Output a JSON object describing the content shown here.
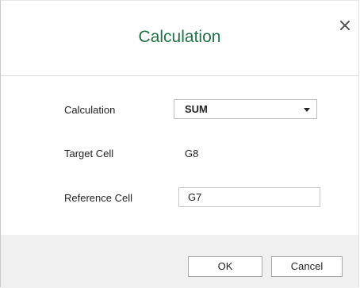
{
  "dialog": {
    "title": "Calculation",
    "close_icon": "close-icon"
  },
  "form": {
    "calculation_label": "Calculation",
    "calculation_value": "SUM",
    "target_cell_label": "Target Cell",
    "target_cell_value": "G8",
    "reference_cell_label": "Reference Cell",
    "reference_cell_value": "G7"
  },
  "buttons": {
    "ok_label": "OK",
    "cancel_label": "Cancel"
  },
  "colors": {
    "title": "#217346",
    "footer_bg": "#f0f0f0",
    "border": "#c8c8c8"
  }
}
